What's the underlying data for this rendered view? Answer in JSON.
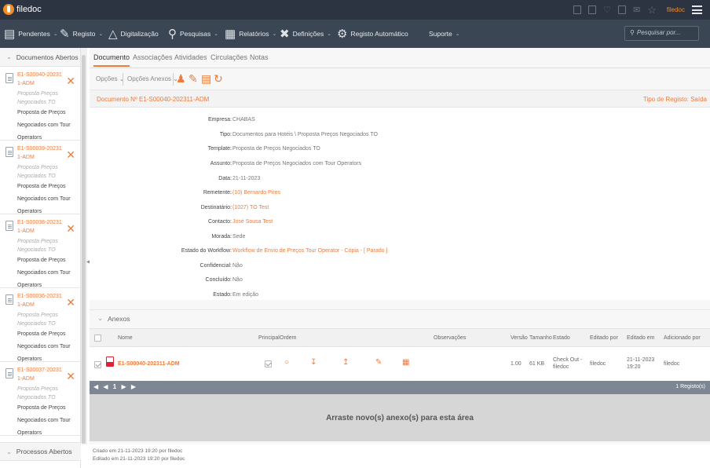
{
  "app": {
    "title": "filedoc",
    "user": "filedoc"
  },
  "menu": {
    "pendentes": "Pendentes",
    "registo": "Registo",
    "digitalizacao": "Digitalização",
    "pesquisas": "Pesquisas",
    "relatorios": "Relatórios",
    "definicoes": "Definições",
    "registo_auto": "Registo Automático",
    "suporte": "Suporte",
    "search_placeholder": "Pesquisar por..."
  },
  "left": {
    "open_docs_title": "Documentos Abertos",
    "items": [
      {
        "num": "E1-S00040-202311-ADM",
        "sub": "Proposta Preços Negociados TO",
        "desc": "Proposta de Preços Negociados com Tour Operators"
      },
      {
        "num": "E1-S00039-202311-ADM",
        "sub": "Proposta Preços Negociados TO",
        "desc": "Proposta de Preços Negociados com Tour Operators"
      },
      {
        "num": "E1-S00038-202311-ADM",
        "sub": "Proposta Preços Negociados TO",
        "desc": "Proposta de Preços Negociados com Tour Operators"
      },
      {
        "num": "E1-S00036-202311-ADM",
        "sub": "Proposta Preços Negociados TO",
        "desc": "Proposta de Preços Negociados com Tour Operators"
      },
      {
        "num": "E1-S00037-202311-ADM",
        "sub": "Proposta Preços Negociados TO",
        "desc": "Proposta de Preços Negociados com Tour Operators"
      }
    ],
    "processes_title": "Processos Abertos"
  },
  "tabs": [
    "Documento",
    "Associações",
    "Atividades",
    "Circulações",
    "Notas"
  ],
  "toolbar": {
    "opcoes": "Opções",
    "opcoes_anexos": "Opções Anexos"
  },
  "doc": {
    "number_label": "Documento Nº E1-S00040-202311-ADM",
    "tipo_registo": "Tipo de Registo: Saída"
  },
  "fields": [
    {
      "label": "Empresa:",
      "value": "CHABAS",
      "link": false
    },
    {
      "label": "Tipo:",
      "value": "Documentos para Hotéis \\ Proposta Preços Negociados TO",
      "link": false
    },
    {
      "label": "Template:",
      "value": "Proposta de Preços Negociados TO",
      "link": false
    },
    {
      "label": "Assunto:",
      "value": "Proposta de Preços Negociados com Tour Operators",
      "link": false
    },
    {
      "label": "Data:",
      "value": "21-11-2023",
      "link": false
    },
    {
      "label": "Remetente:",
      "value": "(10) Bernardo Pires",
      "link": true
    },
    {
      "label": "Destinatário:",
      "value": "(1027) TO Test",
      "link": true
    },
    {
      "label": "Contacto:",
      "value": "José Sousa Test",
      "link": true
    },
    {
      "label": "Morada:",
      "value": "Sede",
      "link": false
    },
    {
      "label": "Estado do Workflow:",
      "value": "Workflow de Envio de Preços Tour Operator - Cópia - [ Parado ]",
      "link": true
    },
    {
      "label": "Confidencial:",
      "value": "Não",
      "link": false
    },
    {
      "label": "Concluído:",
      "value": "Não",
      "link": false
    },
    {
      "label": "Estado:",
      "value": "Em edição",
      "link": false
    }
  ],
  "anexos": {
    "title": "Anexos",
    "columns": {
      "nome": "Nome",
      "principal": "Principal",
      "ordem": "Ordem",
      "observacoes": "Observações",
      "versao": "Versão",
      "tamanho": "Tamanho",
      "estado": "Estado",
      "editado_por": "Editado por",
      "editado_em": "Editado em",
      "adicionado_por": "Adicionado por"
    },
    "row": {
      "nome": "E1-S00040-202311-ADM",
      "versao": "1.00",
      "tamanho": "61 KB",
      "estado": "Check Out - filedoc",
      "editado_por": "filedoc",
      "editado_em": "21-11-2023 19:20",
      "adicionado_por": "filedoc"
    },
    "pager_page": "1",
    "pager_count": "1 Registo(s)",
    "dropzone": "Arraste novo(s) anexo(s) para esta área"
  },
  "footer": {
    "created": "Criado em 21-11-2023 19:20 por filedoc",
    "edited": "Editado em 21-11-2023 19:20 por filedoc"
  }
}
